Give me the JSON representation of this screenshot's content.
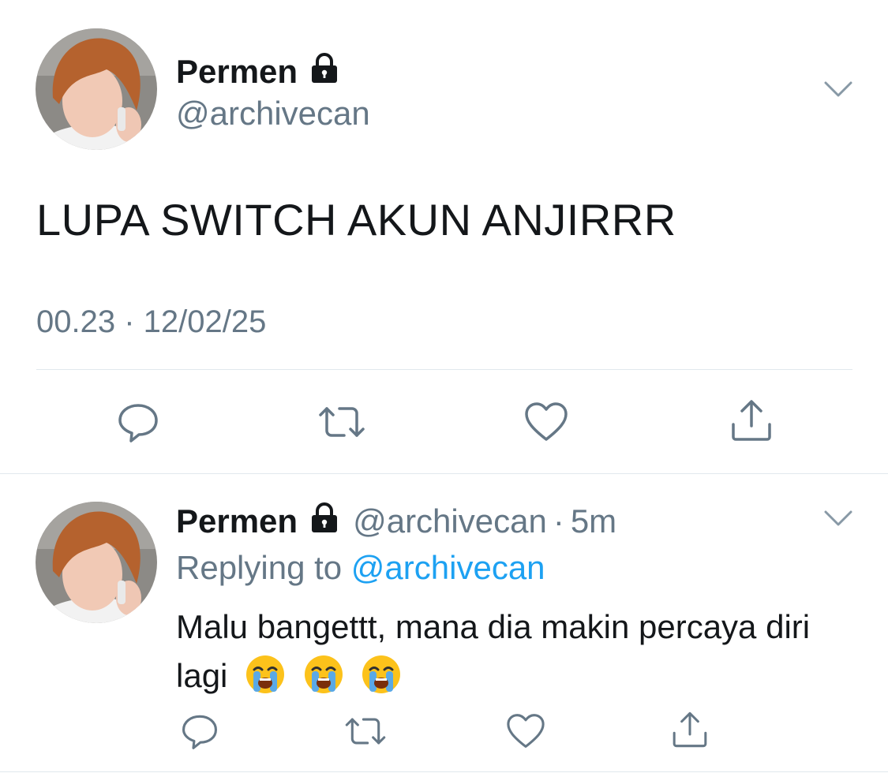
{
  "tweet": {
    "author_name": "Permen",
    "author_handle": "@archivecan",
    "text": "LUPA SWITCH AKUN ANJIRRR",
    "timestamp": "00.23 · 12/02/25"
  },
  "reply": {
    "author_name": "Permen",
    "author_handle": "@archivecan",
    "separator": "·",
    "time_ago": "5m",
    "replying_prefix": "Replying to",
    "replying_mention": "@archivecan",
    "text": "Malu bangettt, mana dia makin percaya diri lagi",
    "emojis": [
      "loudly-crying-face",
      "loudly-crying-face",
      "loudly-crying-face"
    ]
  },
  "icons": {
    "reply": "speech-bubble-icon",
    "retweet": "retweet-icon",
    "like": "heart-icon",
    "share": "share-icon",
    "lock": "lock-icon",
    "menu": "chevron-down-icon"
  },
  "colors": {
    "text": "#14171a",
    "secondary": "#657786",
    "link": "#1da1f2",
    "divider": "#e1e8ed"
  }
}
